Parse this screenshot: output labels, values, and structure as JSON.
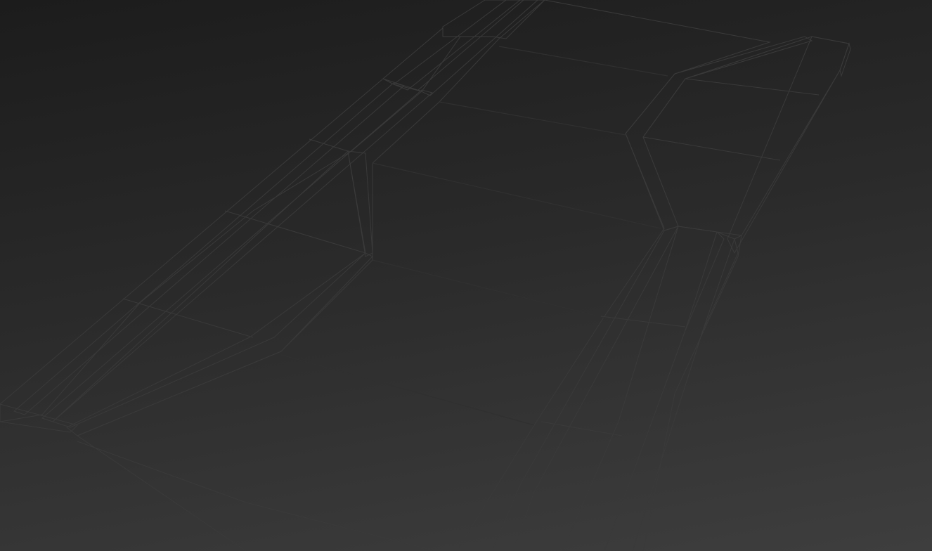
{
  "viewport": {
    "background_top": "#1c1c1c",
    "background_bottom": "#3e3e3e",
    "mesh_face_color": "#8c8c8c",
    "mesh_light_color": "#a8a8a8",
    "mesh_shadow_color": "#6e6e6e",
    "edge_color": "#3a3a3a"
  },
  "model": {
    "description_visible_text": ""
  }
}
